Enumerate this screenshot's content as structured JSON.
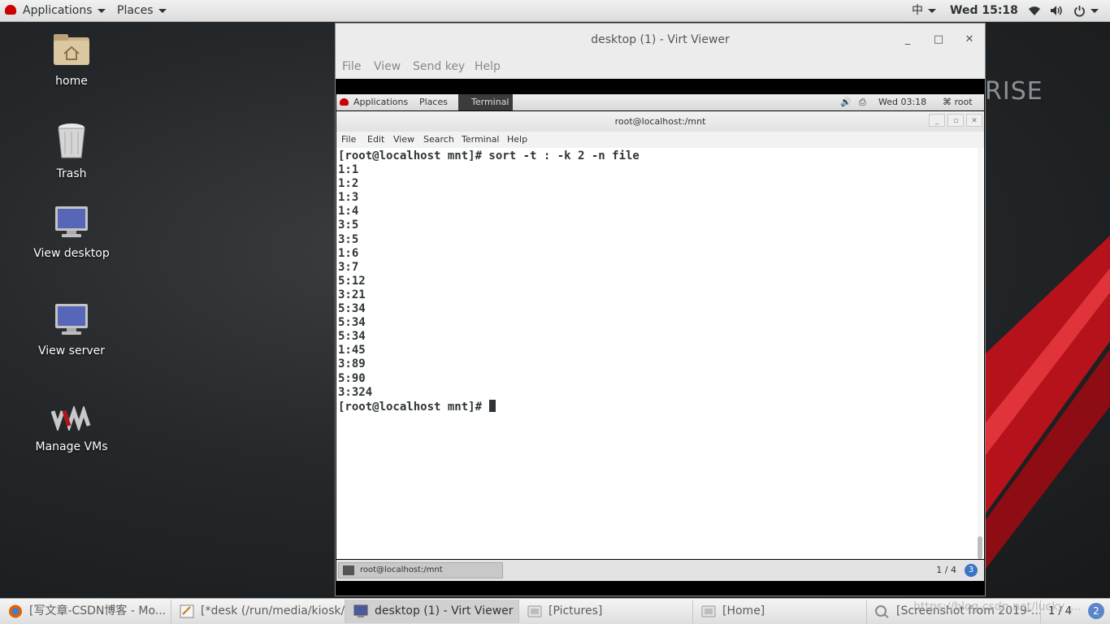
{
  "topbar": {
    "applications": "Applications",
    "places": "Places",
    "input_method": "中",
    "clock": "Wed 15:18"
  },
  "desktop": {
    "brand_text": "RISE",
    "icons": [
      {
        "label": "home",
        "icon": "home-folder-icon"
      },
      {
        "label": "Trash",
        "icon": "trash-icon"
      },
      {
        "label": "View desktop",
        "icon": "monitor-icon"
      },
      {
        "label": "View server",
        "icon": "monitor-icon"
      },
      {
        "label": "Manage VMs",
        "icon": "virt-manager-icon"
      }
    ]
  },
  "virt_viewer": {
    "title": "desktop (1) - Virt Viewer",
    "menu": [
      "File",
      "View",
      "Send key",
      "Help"
    ],
    "guest": {
      "topbar": {
        "applications": "Applications",
        "places": "Places",
        "terminal": "Terminal",
        "clock": "Wed 03:18",
        "user": "root"
      },
      "terminal": {
        "title": "root@localhost:/mnt",
        "menu": [
          "File",
          "Edit",
          "View",
          "Search",
          "Terminal",
          "Help"
        ],
        "lines": [
          "[root@localhost mnt]# sort -t : -k 2 -n file",
          "1:1",
          "1:2",
          "1:3",
          "1:4",
          "3:5",
          "3:5",
          "1:6",
          "3:7",
          "5:12",
          "3:21",
          "5:34",
          "5:34",
          "5:34",
          "1:45",
          "3:89",
          "5:90",
          "3:324"
        ],
        "prompt": "[root@localhost mnt]# "
      },
      "bottom": {
        "task": "root@localhost:/mnt",
        "workspace": "1 / 4",
        "workspace_badge": "3"
      }
    }
  },
  "taskbar": {
    "items": [
      {
        "label": "[写文章-CSDN博客 - Mo...",
        "icon": "firefox-icon"
      },
      {
        "label": "[*desk (/run/media/kiosk/...",
        "icon": "text-editor-icon"
      },
      {
        "label": "desktop (1) - Virt Viewer",
        "icon": "virt-viewer-icon",
        "active": true
      },
      {
        "label": "[Pictures]",
        "icon": "folder-icon"
      },
      {
        "label": "[Home]",
        "icon": "folder-icon"
      },
      {
        "label": "[Screenshot from 2019-...",
        "icon": "image-viewer-icon"
      }
    ],
    "workspace": "1 / 4",
    "workspace_badge": "2",
    "watermark": "https://blog.csdn.net/lucky_..."
  }
}
